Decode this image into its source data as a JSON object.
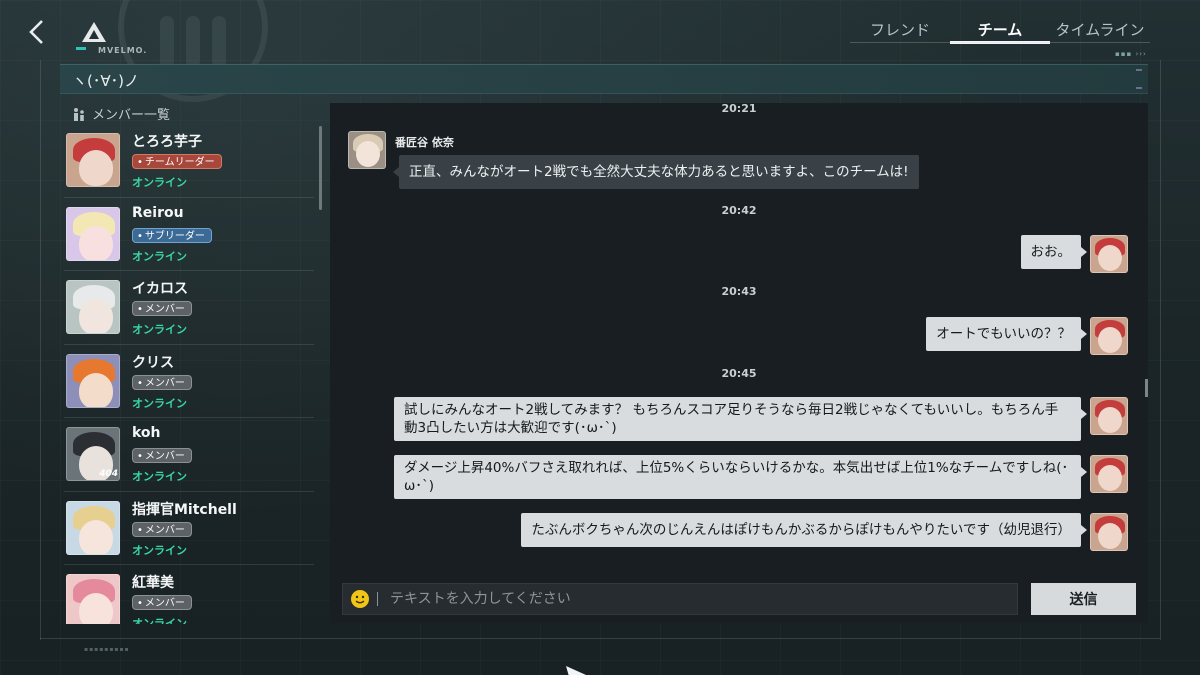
{
  "header": {
    "logo_text": "MVELMO.",
    "tabs": [
      {
        "label": "フレンド"
      },
      {
        "label": "チーム"
      },
      {
        "label": "タイムライン"
      }
    ],
    "active_tab": "チーム"
  },
  "team": {
    "name": "ヽ(･∀･)ノ"
  },
  "members": {
    "header_label": "メンバー一覧",
    "list": [
      {
        "name": "とろろ芋子",
        "role": "チームリーダー",
        "status": "オンライン"
      },
      {
        "name": "Reirou",
        "role": "サブリーダー",
        "status": "オンライン"
      },
      {
        "name": "イカロス",
        "role": "メンバー",
        "status": "オンライン"
      },
      {
        "name": "クリス",
        "role": "メンバー",
        "status": "オンライン"
      },
      {
        "name": "koh",
        "role": "メンバー",
        "status": "オンライン",
        "avatar_tag": "404"
      },
      {
        "name": "指揮官Mitchell",
        "role": "メンバー",
        "status": "オンライン"
      },
      {
        "name": "紅華美",
        "role": "メンバー",
        "status": "オンライン"
      }
    ]
  },
  "chat": {
    "timestamps": [
      "20:21",
      "20:42",
      "20:43",
      "20:45"
    ],
    "messages": [
      {
        "sender": "番匠谷 依奈",
        "text": "正直、みんながオート2戦でも全然大丈夫な体力あると思いますよ、このチームは!"
      },
      {
        "text": "おお。"
      },
      {
        "text": "オートでもいいの？？"
      },
      {
        "text": "試しにみんなオート2戦してみます？ もちろんスコア足りそうなら毎日2戦じゃなくてもいいし。もちろん手動3凸したい方は大歓迎です(･ω･`)"
      },
      {
        "text": "ダメージ上昇40%バフさえ取れれば、上位5%くらいならいけるかな。本気出せば上位1%なチームですしね(･ω･`)"
      },
      {
        "text": "たぶんボクちゃん次のじんえんはぽけもんかぶるからぽけもんやりたいです（幼児退行）"
      }
    ],
    "input_placeholder": "テキストを入力してください",
    "send_label": "送信"
  },
  "colors": {
    "online": "#37d7a4",
    "leader_badge": "#a8483c",
    "sub_leader_badge": "#3c6a96",
    "member_badge": "#5d6266",
    "my_bubble": "#d9dcde",
    "their_bubble": "#3a4146"
  }
}
